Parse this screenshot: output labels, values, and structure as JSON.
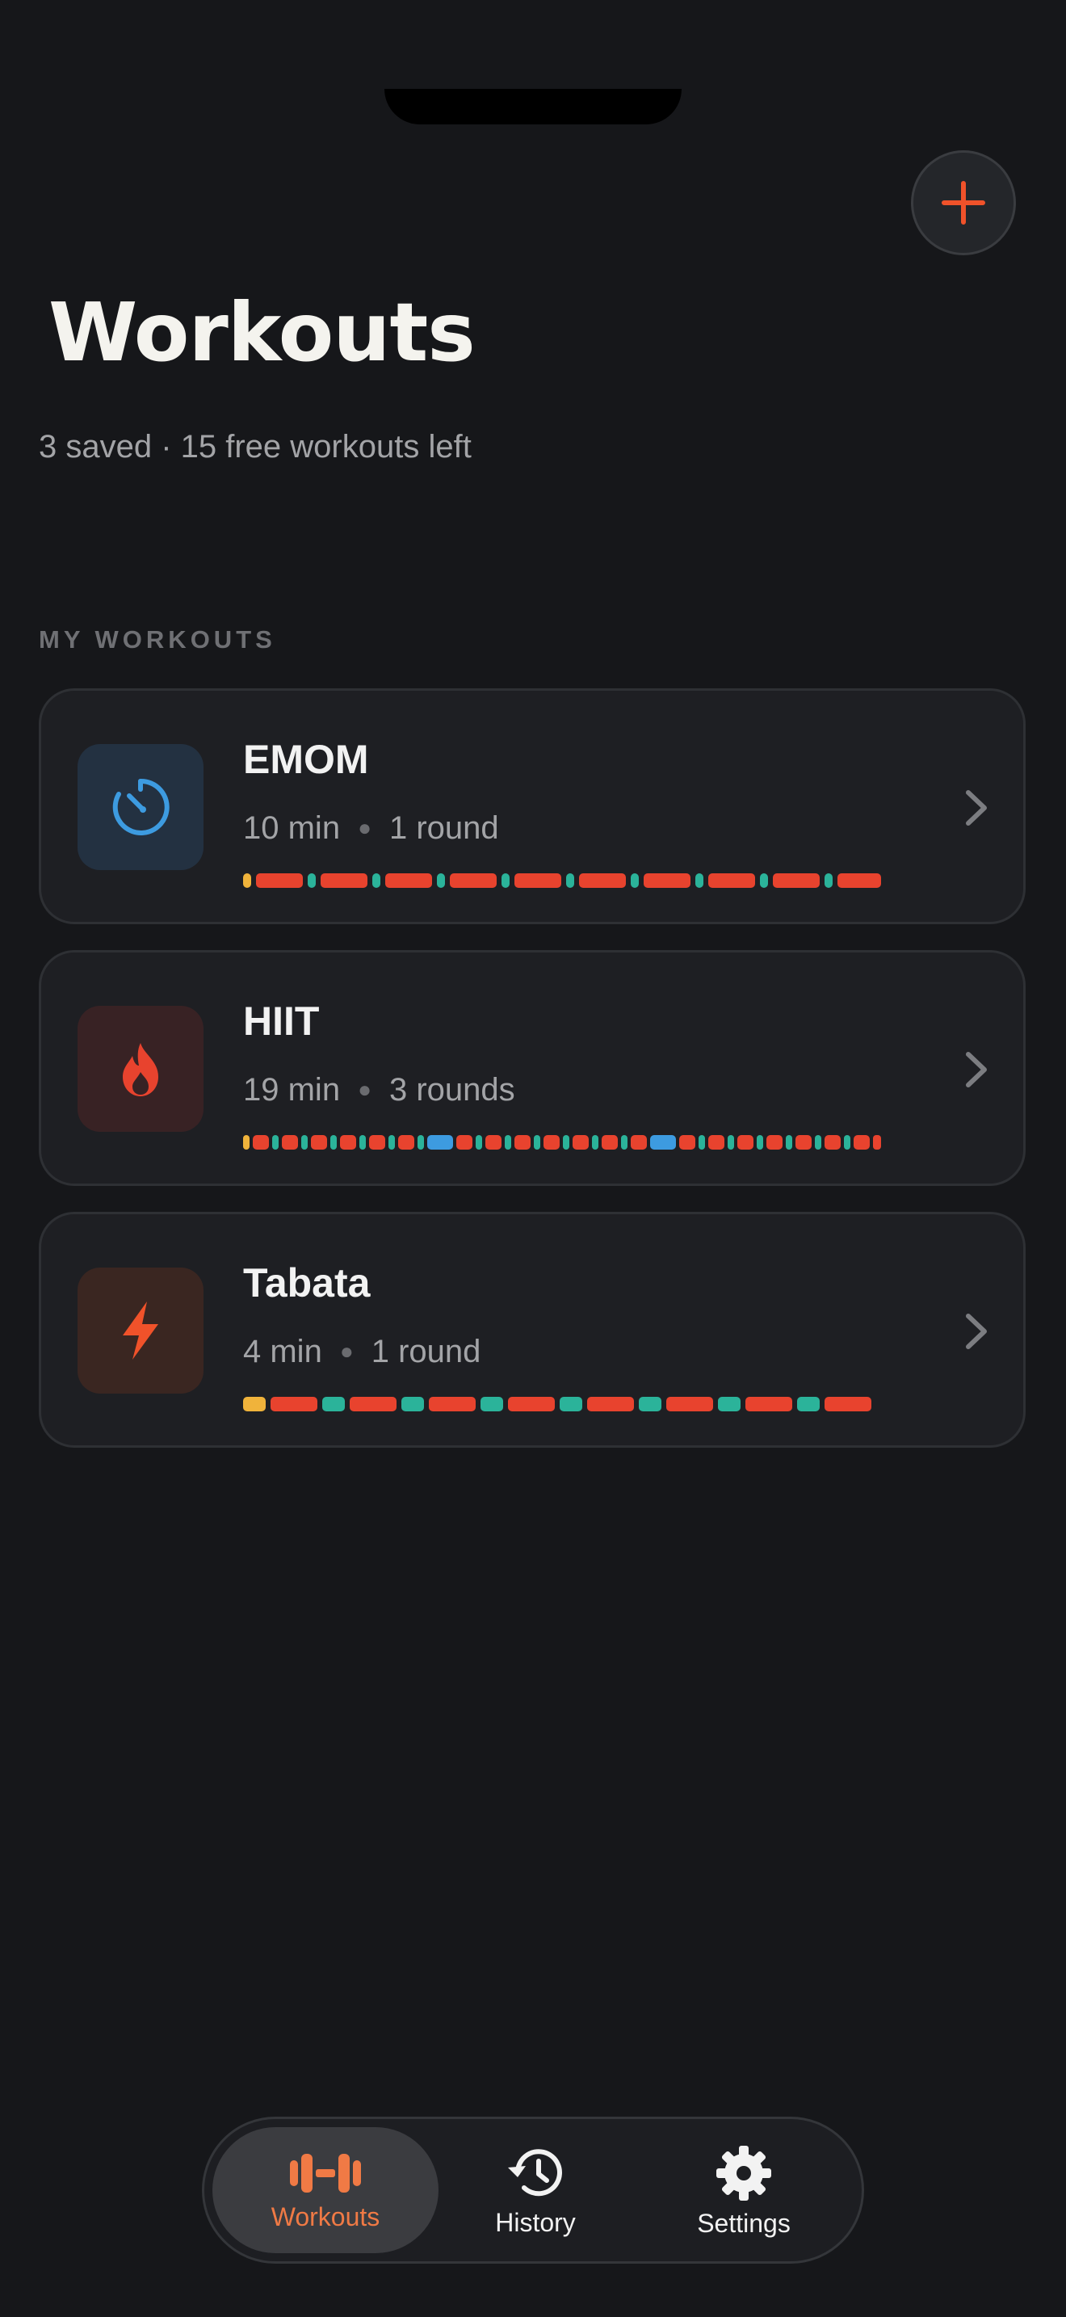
{
  "header": {
    "title": "Workouts",
    "subtitle": "3 saved · 15 free workouts left",
    "add_icon": "plus-icon"
  },
  "section": {
    "label": "MY WORKOUTS"
  },
  "workouts": [
    {
      "name": "EMOM",
      "duration": "10 min",
      "rounds": "1 round",
      "icon": "timer-icon",
      "icon_color": "#3d9be0",
      "icon_bg": "#233141"
    },
    {
      "name": "HIIT",
      "duration": "19 min",
      "rounds": "3 rounds",
      "icon": "flame-icon",
      "icon_color": "#e8432e",
      "icon_bg": "#382224"
    },
    {
      "name": "Tabata",
      "duration": "4 min",
      "rounds": "1 round",
      "icon": "bolt-icon",
      "icon_color": "#f0522a",
      "icon_bg": "#3a2621"
    }
  ],
  "tabbar": {
    "items": [
      {
        "label": "Workouts",
        "icon": "dumbbell-icon",
        "active": true
      },
      {
        "label": "History",
        "icon": "history-icon",
        "active": false
      },
      {
        "label": "Settings",
        "icon": "gear-icon",
        "active": false
      }
    ]
  },
  "colors": {
    "accent": "#f07a45",
    "work": "#e8432e",
    "rest": "#2bb39a",
    "warmup": "#f0b33b",
    "round_rest": "#3d9be0"
  }
}
